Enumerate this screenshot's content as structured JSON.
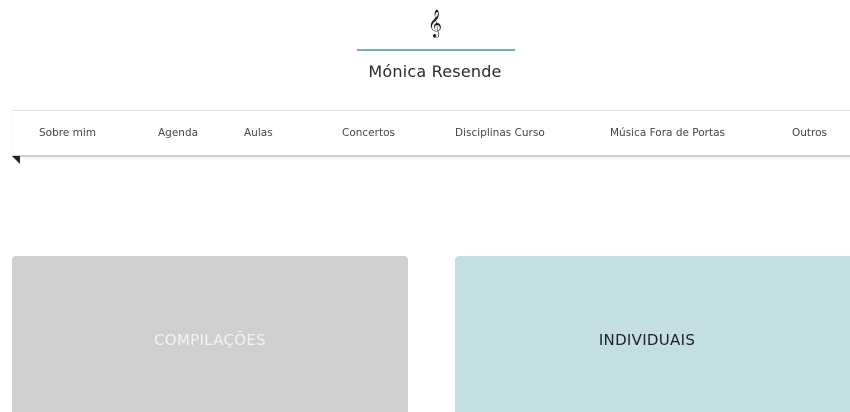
{
  "header": {
    "logo_glyph": "𝄞",
    "logo_icon": "treble-clef-icon",
    "site_title": "Mónica Resende",
    "accent_color": "#6fb3bd"
  },
  "nav": {
    "items": [
      {
        "label": "Sobre mim"
      },
      {
        "label": "Agenda"
      },
      {
        "label": "Aulas"
      },
      {
        "label": "Concertos"
      },
      {
        "label": "Disciplinas Curso"
      },
      {
        "label": "Música Fora de Portas"
      },
      {
        "label": "Outros"
      }
    ]
  },
  "tiles": [
    {
      "label": "COMPILAÇÕES",
      "color": "#cfcfcf"
    },
    {
      "label": "INDIVIDUAIS",
      "color": "#c4dfe3"
    }
  ]
}
